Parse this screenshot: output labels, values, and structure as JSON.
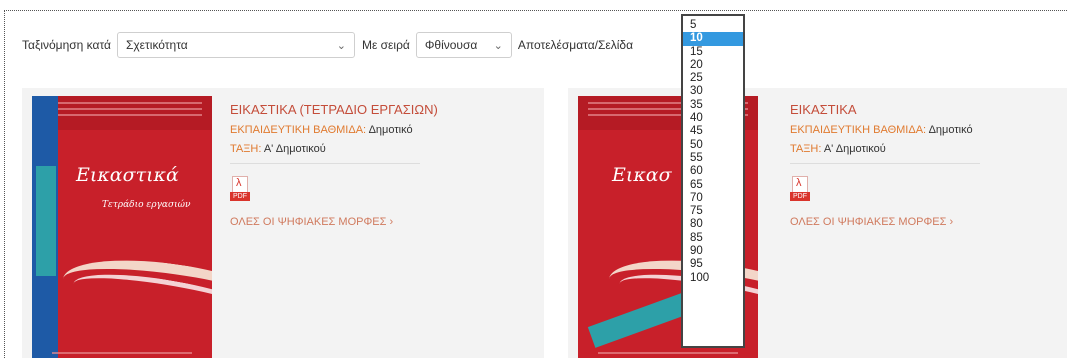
{
  "toolbar": {
    "sort_label": "Ταξινόμηση κατά",
    "sort_value": "Σχετικότητα",
    "order_label": "Με σειρά",
    "order_value": "Φθίνουσα",
    "per_page_label": "Αποτελέσματα/Σελίδα"
  },
  "per_page_options": [
    "5",
    "10",
    "15",
    "20",
    "25",
    "30",
    "35",
    "40",
    "45",
    "50",
    "55",
    "60",
    "65",
    "70",
    "75",
    "80",
    "85",
    "90",
    "95",
    "100"
  ],
  "per_page_selected": "10",
  "books": [
    {
      "title": "ΕΙΚΑΣΤΙΚΑ (ΤΕΤΡΑΔΙΟ ΕΡΓΑΣΙΩΝ)",
      "level_label": "ΕΚΠΑΙΔΕΥΤΙΚΗ ΒΑΘΜΙΔΑ:",
      "level_value": "Δημοτικό",
      "class_label": "ΤΑΞΗ:",
      "class_value": "Α' Δημοτικού",
      "pdf_label": "PDF",
      "all_formats": "ΟΛΕΣ ΟΙ ΨΗΦΙΑΚΕΣ ΜΟΡΦΕΣ",
      "cover_title": "Εικαστικά",
      "cover_subtitle": "Τετράδιο εργασιών"
    },
    {
      "title": "ΕΙΚΑΣΤΙΚΑ",
      "level_label": "ΕΚΠΑΙΔΕΥΤΙΚΗ ΒΑΘΜΙΔΑ:",
      "level_value": "Δημοτικό",
      "class_label": "ΤΑΞΗ:",
      "class_value": "Α' Δημοτικού",
      "pdf_label": "PDF",
      "all_formats": "ΟΛΕΣ ΟΙ ΨΗΦΙΑΚΕΣ ΜΟΡΦΕΣ",
      "cover_title": "Εικασ"
    }
  ],
  "icons": {
    "chevron": "chevron-down-icon",
    "pdf": "pdf-icon",
    "arrow": "chevron-right-icon"
  },
  "colors": {
    "accent": "#c44d3a",
    "label_orange": "#e07a2f",
    "dropdown_highlight": "#3399e0",
    "cover_red": "#c8202a"
  }
}
